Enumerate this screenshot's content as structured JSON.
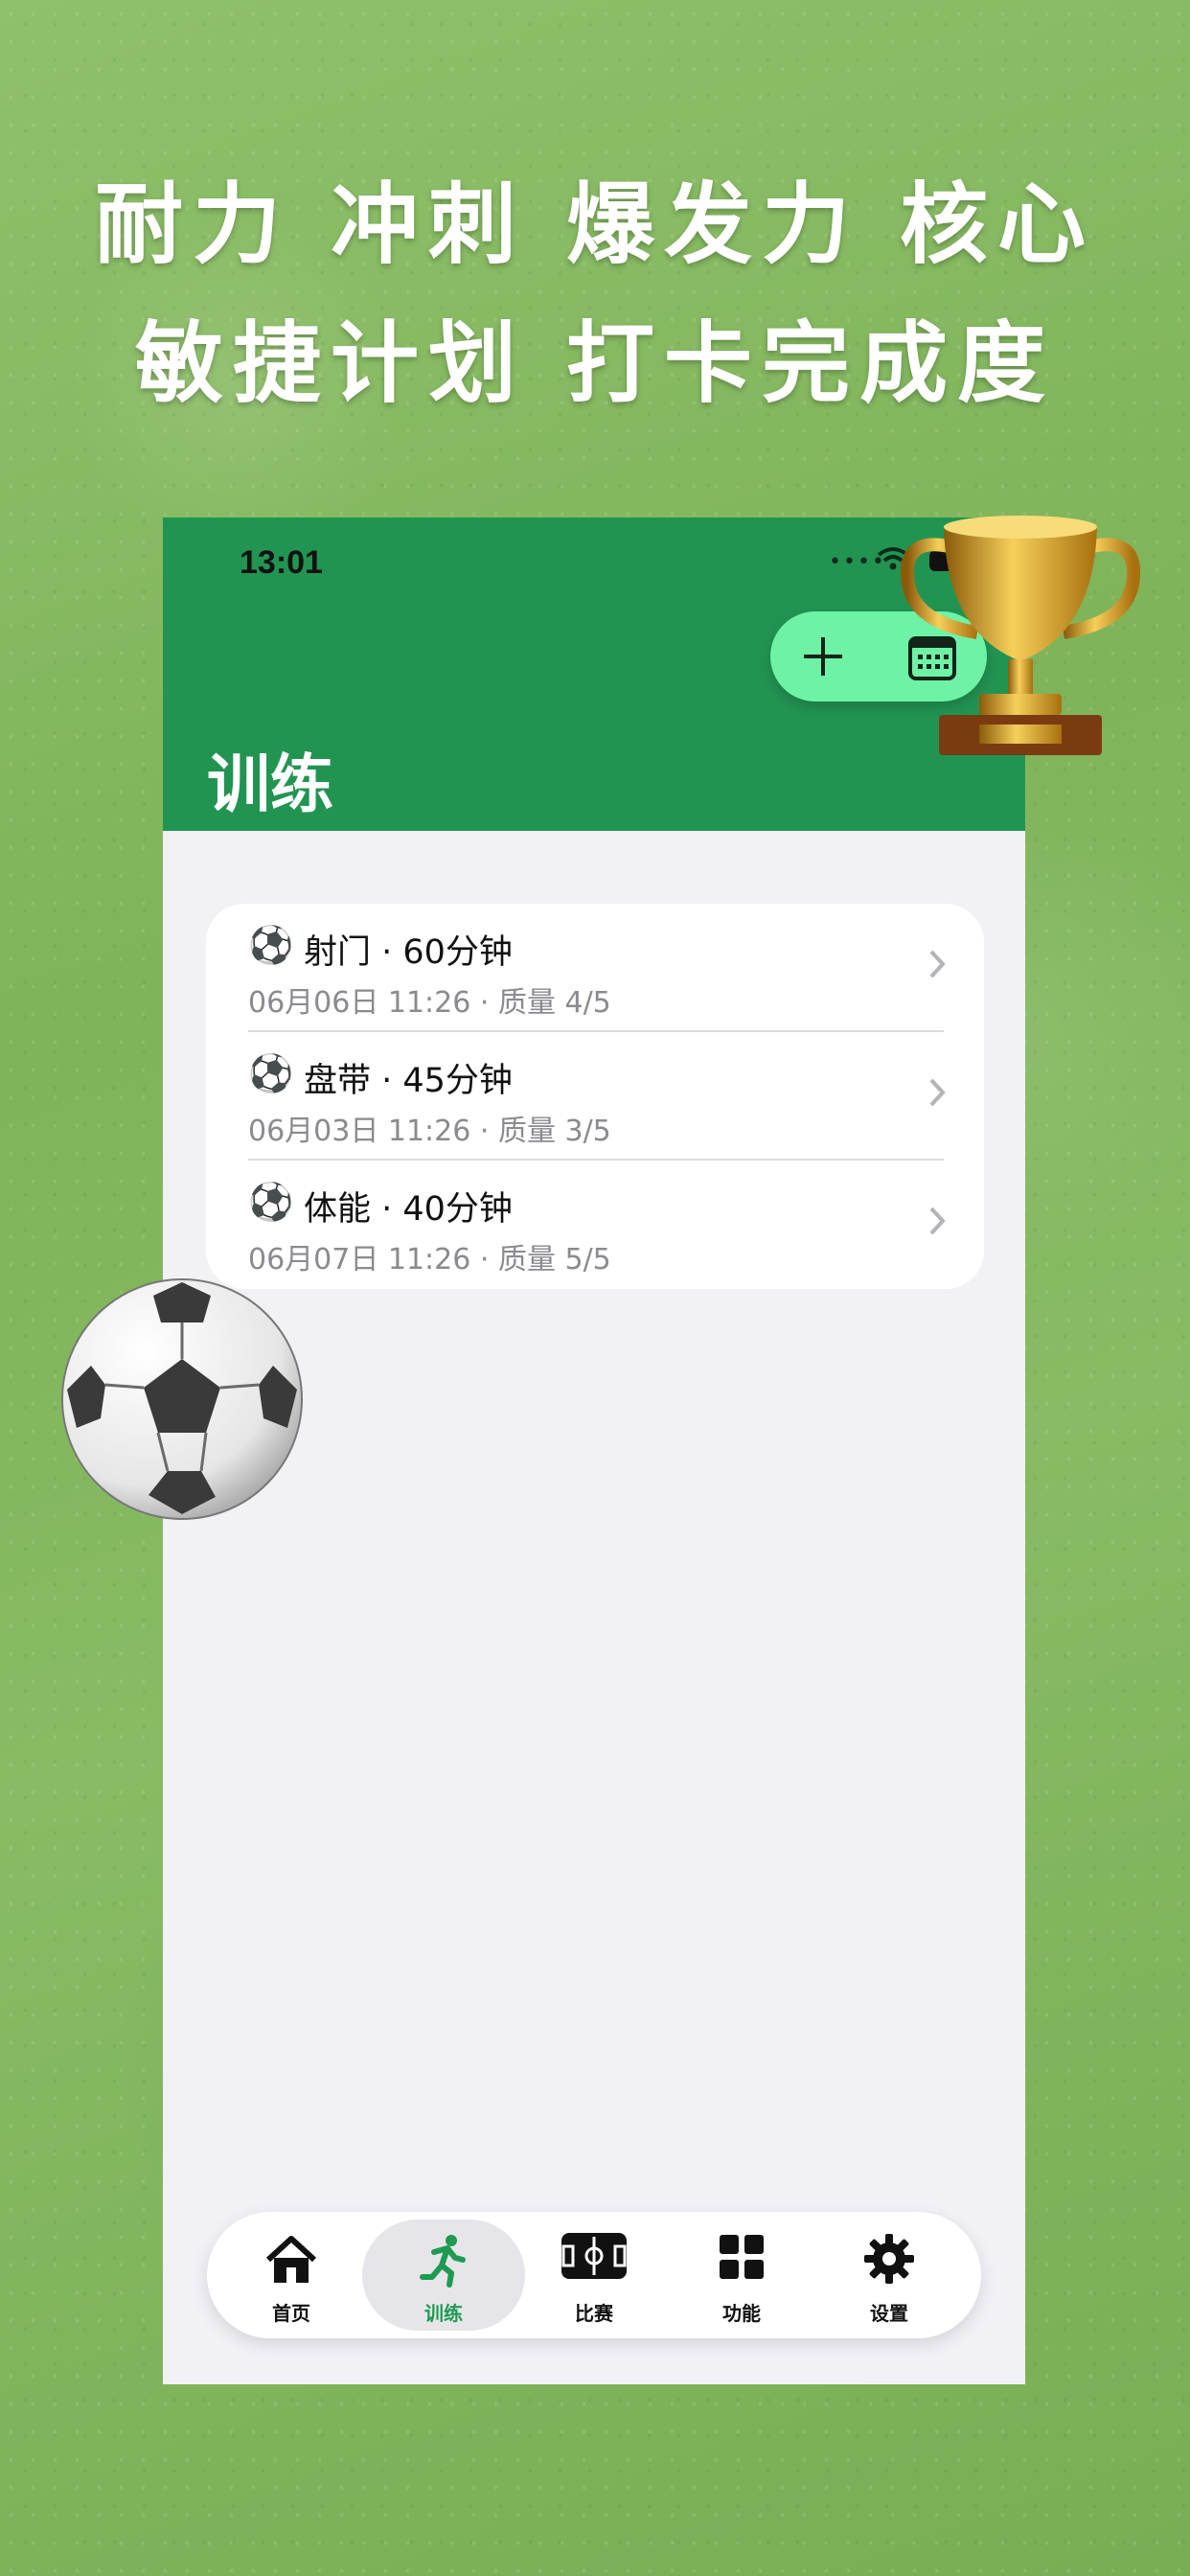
{
  "headline": {
    "line1": "耐力 冲刺 爆发力 核心",
    "line2": "敏捷计划 打卡完成度"
  },
  "status_bar": {
    "time": "13:01",
    "cellular": "••••"
  },
  "header": {
    "title": "训练",
    "color": "#229452",
    "actions": {
      "add_icon": "plus-icon",
      "calendar_icon": "calendar-icon",
      "pill_color": "#6ef3a6"
    }
  },
  "sessions": [
    {
      "icon": "⚽",
      "title": "射门 · 60分钟",
      "subtitle": "06月06日 11:26 · 质量 4/5"
    },
    {
      "icon": "⚽",
      "title": "盘带 · 45分钟",
      "subtitle": "06月03日 11:26 · 质量 3/5"
    },
    {
      "icon": "⚽",
      "title": "体能 · 40分钟",
      "subtitle": "06月07日 11:26 · 质量 5/5"
    }
  ],
  "tabbar": {
    "active": "训练",
    "active_color": "#1f9a52",
    "tabs": [
      {
        "label": "首页",
        "icon": "home-icon"
      },
      {
        "label": "训练",
        "icon": "running-icon"
      },
      {
        "label": "比赛",
        "icon": "pitch-icon"
      },
      {
        "label": "功能",
        "icon": "grid-icon"
      },
      {
        "label": "设置",
        "icon": "gear-icon"
      }
    ]
  }
}
